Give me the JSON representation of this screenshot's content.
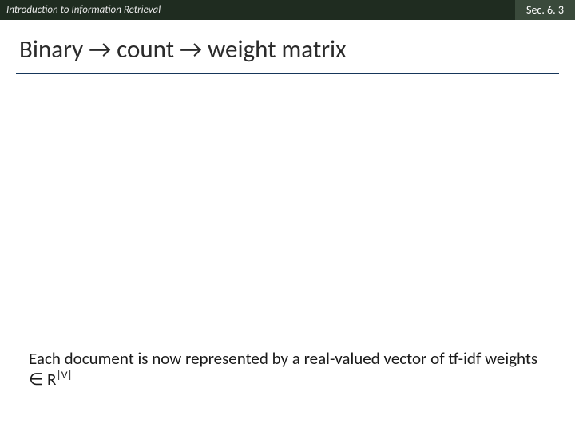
{
  "header": {
    "course": "Introduction to Information Retrieval",
    "section": "Sec. 6. 3"
  },
  "title": "Binary → count → weight matrix",
  "body": {
    "sentence_part1": "Each document is now represented by a real-valued vector of tf-idf weights ∈ R",
    "exponent": "|V|"
  }
}
